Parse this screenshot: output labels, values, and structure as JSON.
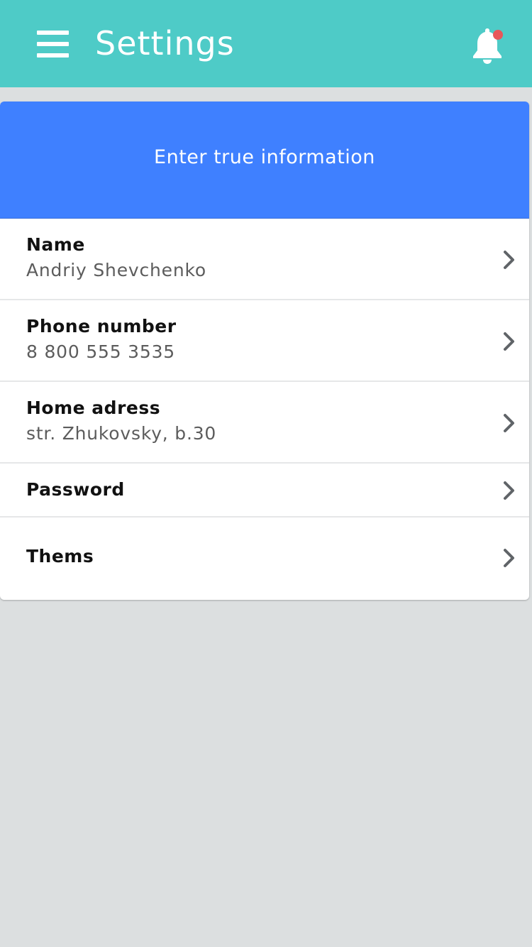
{
  "header": {
    "title": "Settings",
    "menu_icon": "hamburger-menu-icon",
    "notification_icon": "bell-icon",
    "has_unread_notification": true,
    "bar_color": "#4ecbc7",
    "dot_color": "#e8575a"
  },
  "card": {
    "banner_text": "Enter true information",
    "banner_color": "#3f80ff",
    "rows": [
      {
        "label": "Name",
        "value": "Andriy Shevchenko"
      },
      {
        "label": "Phone number",
        "value": "8 800 555 3535"
      },
      {
        "label": "Home adress",
        "value": "str. Zhukovsky, b.30"
      },
      {
        "label": "Password"
      },
      {
        "label": "Thems"
      }
    ],
    "row_icon": "chevron-right-icon"
  }
}
